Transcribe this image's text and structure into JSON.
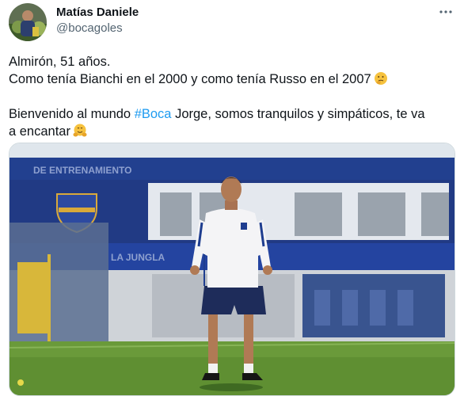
{
  "author": {
    "display_name": "Matías Daniele",
    "handle": "@bocagoles",
    "avatar_icon": "profile-photo"
  },
  "menu_icon": "more-horizontal-icon",
  "tweet": {
    "line1": "Almirón, 51 años.",
    "line2": "Como tenía Bianchi en el 2000 y como tenía Russo en el 2007",
    "line2_emoji": "thinking-face-emoji",
    "line3_before": "Bienvenido al mundo ",
    "hashtag": "#Boca",
    "line3_after": " Jorge, somos tranquilos y simpáticos, te va",
    "line4": "a encantar",
    "line4_emoji": "hugging-face-emoji"
  },
  "media": {
    "image_icon": "photo-coach-on-training-field",
    "building_sign_top": "DE ENTRENAMIENTO",
    "building_sign_bottom": "LA JUNGLA"
  },
  "colors": {
    "link": "#1d9bf0",
    "secondary_text": "#536471",
    "building_blue": "#1e3d8f",
    "grass": "#6a9a3a"
  }
}
